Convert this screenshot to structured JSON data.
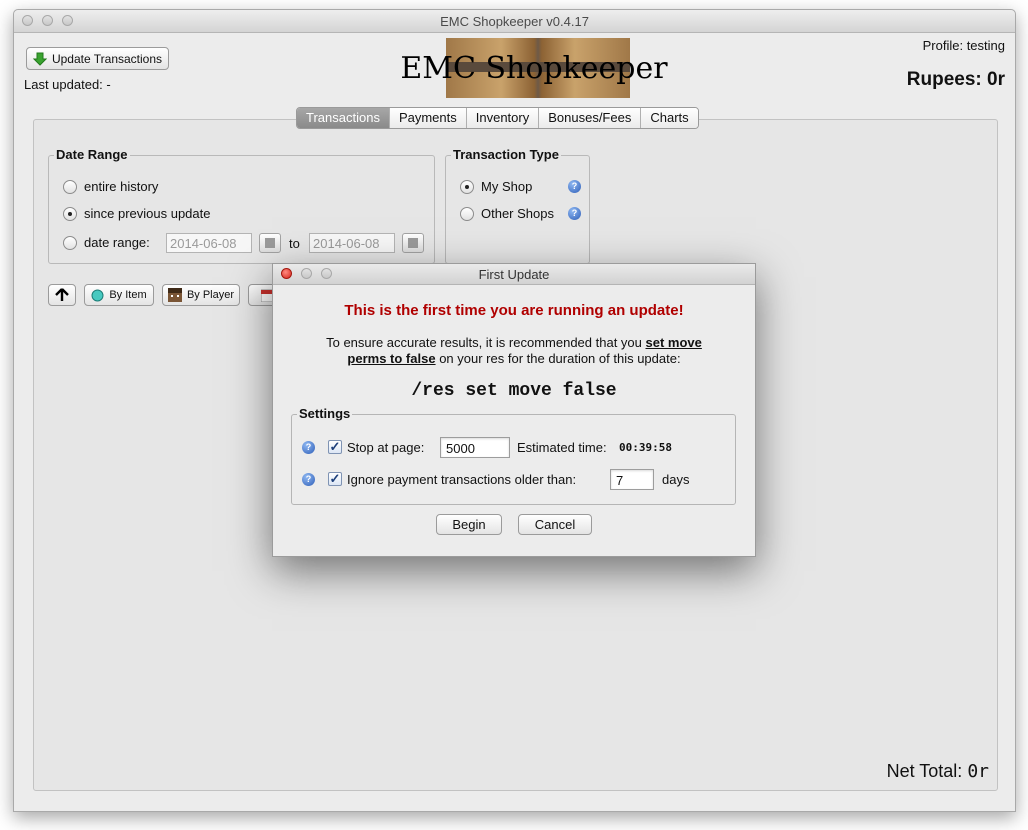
{
  "window": {
    "title": "EMC Shopkeeper v0.4.17"
  },
  "header": {
    "update_button": "Update Transactions",
    "last_updated": "Last updated: -",
    "app_title": "EMC Shopkeeper",
    "profile": "Profile: testing",
    "rupees": "Rupees: 0r"
  },
  "tabs": [
    {
      "label": "Transactions",
      "selected": true
    },
    {
      "label": "Payments",
      "selected": false
    },
    {
      "label": "Inventory",
      "selected": false
    },
    {
      "label": "Bonuses/Fees",
      "selected": false
    },
    {
      "label": "Charts",
      "selected": false
    }
  ],
  "date_range": {
    "title": "Date Range",
    "options": [
      "entire history",
      "since previous update",
      "date range:"
    ],
    "selected": "since previous update",
    "from": "2014-06-08",
    "to_label": "to",
    "to": "2014-06-08"
  },
  "transaction_type": {
    "title": "Transaction Type",
    "options": [
      "My Shop",
      "Other Shops"
    ],
    "selected": "My Shop"
  },
  "toolbar": {
    "by_item": "By Item",
    "by_player": "By Player"
  },
  "footer": {
    "net_total_label": "Net Total:",
    "net_total_value": "0r"
  },
  "dialog": {
    "title": "First Update",
    "headline": "This is the first time you are running an update!",
    "msg_pre": "To ensure accurate results, it is recommended that you",
    "msg_link1": "set move",
    "msg_link2": "perms to false",
    "msg_post": "on your res for the duration of this update:",
    "command": "/res set move false",
    "settings_title": "Settings",
    "stop_label": "Stop at page:",
    "stop_value": "5000",
    "est_label": "Estimated time:",
    "est_value": "00:39:58",
    "ignore_label": "Ignore payment transactions older than:",
    "ignore_value": "7",
    "days_label": "days",
    "begin": "Begin",
    "cancel": "Cancel",
    "accent": "#b00000"
  }
}
